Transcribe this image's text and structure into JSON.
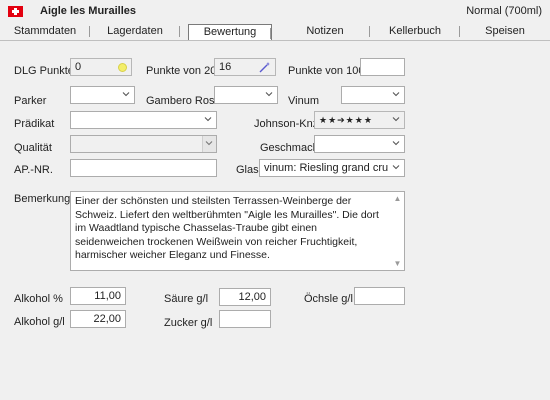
{
  "header": {
    "title": "Aigle les Murailles",
    "bottle": "Normal (700ml)",
    "flag_color": "#e3000f"
  },
  "tabs": [
    "Stammdaten",
    "Lagerdaten",
    "Bewertung",
    "Notizen",
    "Kellerbuch",
    "Speisen"
  ],
  "active_tab": "Bewertung",
  "ratings": {
    "dlg_label": "DLG Punkte",
    "dlg_value": "0",
    "p20_label": "Punkte von 20",
    "p20_value": "16",
    "p100_label": "Punkte von 100",
    "p100_value": ""
  },
  "guides": {
    "parker_label": "Parker",
    "parker_value": "",
    "gambero_label": "Gambero Rosso",
    "gambero_value": "",
    "vinum_label": "Vinum",
    "vinum_value": "",
    "praedikat_label": "Prädikat",
    "praedikat_value": "",
    "johnson_label": "Johnson-Knz.",
    "johnson_value": "★★➔★★★",
    "qualitaet_label": "Qualität",
    "qualitaet_value": "",
    "geschmack_label": "Geschmack",
    "geschmack_value": "",
    "ap_label": "AP.-NR.",
    "ap_value": "",
    "glas_label": "Glas",
    "glas_value": "vinum: Riesling grand cru"
  },
  "remark": {
    "label": "Bemerkung",
    "text": "Einer der schönsten und steilsten Terrassen-Weinberge der Schweiz. Liefert den weltberühmten \"Aigle les Murailles\". Die dort im Waadtland typische Chasselas-Traube gibt einen seidenweichen trockenen Weißwein von reicher Fruchtigkeit, harmischer weicher Eleganz und Finesse."
  },
  "analysis": {
    "alkohol_pct_label": "Alkohol %",
    "alkohol_pct_value": "11,00",
    "alkohol_gl_label": "Alkohol g/l",
    "alkohol_gl_value": "22,00",
    "saeure_label": "Säure g/l",
    "saeure_value": "12,00",
    "zucker_label": "Zucker g/l",
    "zucker_value": "",
    "oechsle_label": "Öchsle g/l",
    "oechsle_value": ""
  }
}
